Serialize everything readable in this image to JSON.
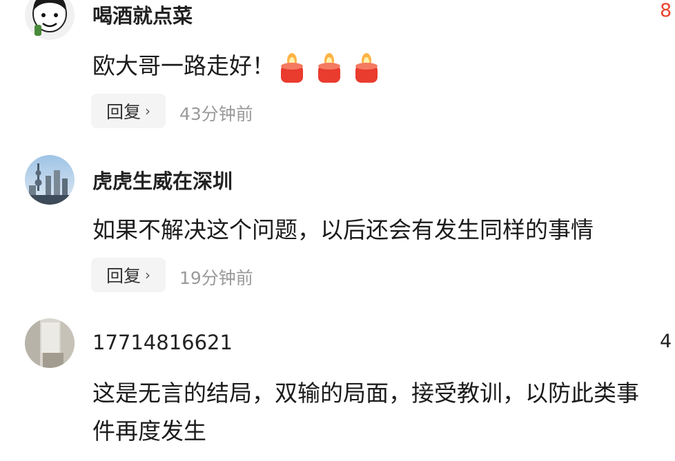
{
  "comments": [
    {
      "username": "喝酒就点菜",
      "like_count_partial": "8",
      "text": "欧大哥一路走好！",
      "emojis": [
        "candle-icon",
        "candle-icon",
        "candle-icon"
      ],
      "reply_label": "回复",
      "time": "43分钟前",
      "avatar": "meme-avatar"
    },
    {
      "username": "虎虎生威在深圳",
      "text": "如果不解决这个问题，以后还会有发生同样的事情",
      "reply_label": "回复",
      "time": "19分钟前",
      "avatar": "city-skyline-avatar"
    },
    {
      "username": "17714816621",
      "like_count_partial": "4",
      "text_line1": "这是无言的结局，双输的局面，接受教训，以防此类事",
      "text_line2": "件再度发生",
      "avatar": "room-photo-avatar"
    }
  ],
  "colors": {
    "like_red": "#e8452f",
    "like_gray": "#222222",
    "reply_bg": "#f4f4f4",
    "time_gray": "#9a9a9a"
  }
}
